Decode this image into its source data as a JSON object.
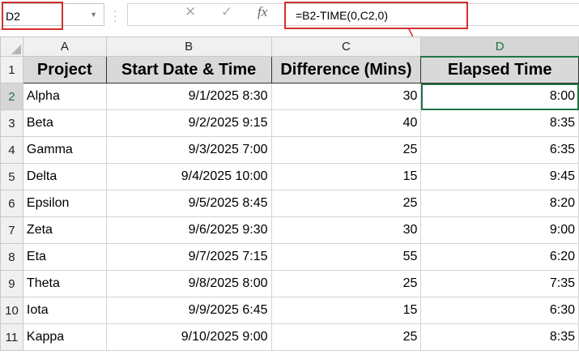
{
  "name_box": "D2",
  "formula": "=B2-TIME(0,C2,0)",
  "fx_label": "fx",
  "columns": [
    "A",
    "B",
    "C",
    "D"
  ],
  "headers": [
    "Project",
    "Start Date & Time",
    "Difference (Mins)",
    "Elapsed Time"
  ],
  "rows": [
    {
      "n": "2",
      "p": "Alpha",
      "s": "9/1/2025 8:30",
      "d": "30",
      "e": "8:00"
    },
    {
      "n": "3",
      "p": "Beta",
      "s": "9/2/2025 9:15",
      "d": "40",
      "e": "8:35"
    },
    {
      "n": "4",
      "p": "Gamma",
      "s": "9/3/2025 7:00",
      "d": "25",
      "e": "6:35"
    },
    {
      "n": "5",
      "p": "Delta",
      "s": "9/4/2025 10:00",
      "d": "15",
      "e": "9:45"
    },
    {
      "n": "6",
      "p": "Epsilon",
      "s": "9/5/2025 8:45",
      "d": "25",
      "e": "8:20"
    },
    {
      "n": "7",
      "p": "Zeta",
      "s": "9/6/2025 9:30",
      "d": "30",
      "e": "9:00"
    },
    {
      "n": "8",
      "p": "Eta",
      "s": "9/7/2025 7:15",
      "d": "55",
      "e": "6:20"
    },
    {
      "n": "9",
      "p": "Theta",
      "s": "9/8/2025 8:00",
      "d": "25",
      "e": "7:35"
    },
    {
      "n": "10",
      "p": "Iota",
      "s": "9/9/2025 6:45",
      "d": "15",
      "e": "6:30"
    },
    {
      "n": "11",
      "p": "Kappa",
      "s": "9/10/2025 9:00",
      "d": "25",
      "e": "8:35"
    }
  ],
  "header_row_num": "1",
  "colors": {
    "accent": "#217346",
    "highlight": "#d32f2f"
  }
}
